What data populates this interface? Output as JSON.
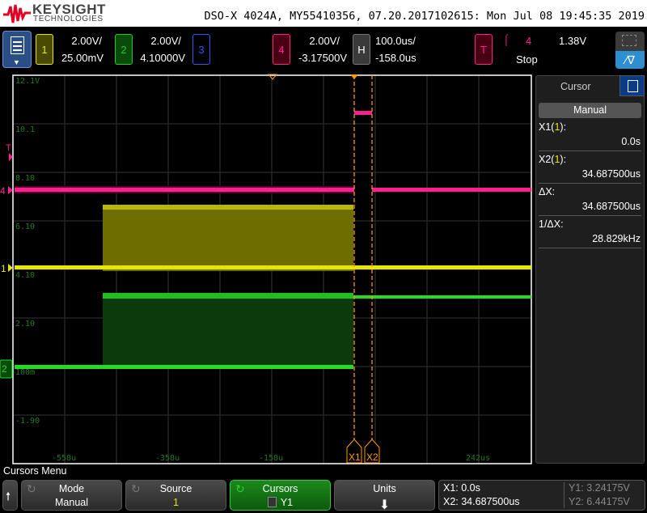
{
  "header": {
    "brand": "KEYSIGHT",
    "brand_sub": "TECHNOLOGIES",
    "title": "DSO-X 4024A, MY55410356, 07.20.2017102615: Mon Jul 08 19:45:35 2019"
  },
  "channels": [
    {
      "id": "1",
      "scale": "2.00V/",
      "offset": "25.00mV",
      "color": "#e6e600"
    },
    {
      "id": "2",
      "scale": "2.00V/",
      "offset": "4.10000V",
      "color": "#22cc22"
    },
    {
      "id": "3",
      "scale": "",
      "offset": "",
      "color": "#3355ff"
    },
    {
      "id": "4",
      "scale": "2.00V/",
      "offset": "-3.17500V",
      "color": "#ff1f8f"
    }
  ],
  "horizontal": {
    "id": "H",
    "scale": "100.0us/",
    "delay": "-158.0us"
  },
  "trigger": {
    "id": "T",
    "source": "4",
    "level": "1.38V",
    "status": "Stop"
  },
  "graticule": {
    "y_labels": [
      "12.1V",
      "10.1",
      "8.10",
      "6.10",
      "4.10",
      "2.10",
      "100m",
      "-1.90"
    ],
    "x_labels": [
      "-558u",
      "-358u",
      "-158u",
      "",
      "242us"
    ],
    "markers": {
      "ch4": "4",
      "ch1": "1",
      "ch2": "2",
      "trig": "T"
    },
    "cursor_labels": [
      "X1",
      "X2"
    ]
  },
  "cursor_panel": {
    "tab": "Cursor",
    "mode": "Manual",
    "rows": [
      {
        "label": "X1(",
        "src": "1",
        "suffix": "):",
        "value": "0.0s"
      },
      {
        "label": "X2(",
        "src": "1",
        "suffix": "):",
        "value": "34.687500us"
      },
      {
        "label": "ΔX:",
        "src": "",
        "suffix": "",
        "value": "34.687500us"
      },
      {
        "label": "1/ΔX:",
        "src": "",
        "suffix": "",
        "value": "28.829kHz"
      }
    ]
  },
  "softkeys": {
    "menu_title": "Cursors Menu",
    "mode": {
      "label": "Mode",
      "value": "Manual"
    },
    "source": {
      "label": "Source",
      "value": "1"
    },
    "cursors": {
      "label": "Cursors",
      "value": "Y1"
    },
    "units": {
      "label": "Units"
    },
    "readout": {
      "x1": "X1:  0.0s",
      "x2": "X2:  34.687500us",
      "y1": "Y1: 3.24175V",
      "y2": "Y2: 6.44175V"
    }
  }
}
